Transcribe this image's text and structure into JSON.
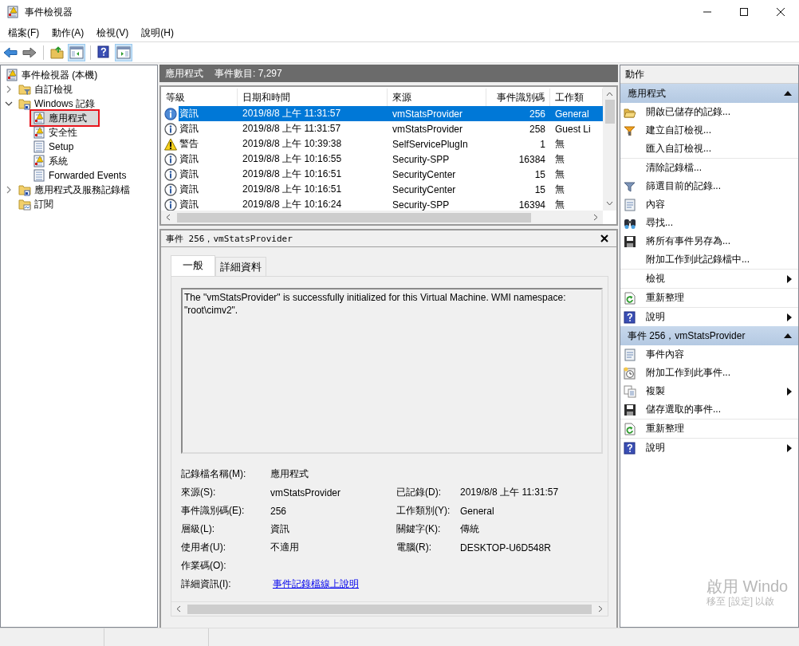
{
  "window": {
    "title": "事件檢視器"
  },
  "menu": [
    "檔案(F)",
    "動作(A)",
    "檢視(V)",
    "說明(H)"
  ],
  "toolbar": [
    {
      "kind": "back",
      "pressed": false
    },
    {
      "kind": "forward",
      "pressed": false
    },
    {
      "kind": "folder-up",
      "pressed": false
    },
    {
      "kind": "tree-pane",
      "pressed": true
    },
    {
      "kind": "help",
      "pressed": false
    },
    {
      "kind": "action-pane",
      "pressed": true
    }
  ],
  "tree": {
    "label": "事件檢視器 (本機)",
    "kind": "root",
    "selected": false,
    "highlighted": false,
    "children": [
      {
        "label": "自訂檢視",
        "kind": "folder-filter",
        "expanded": false,
        "selected": false,
        "highlighted": false
      },
      {
        "label": "Windows 記錄",
        "kind": "folder-logs",
        "expanded": true,
        "selected": false,
        "highlighted": false,
        "children": [
          {
            "label": "應用程式",
            "kind": "log-alert",
            "selected": true,
            "highlighted": true
          },
          {
            "label": "安全性",
            "kind": "log-alert",
            "selected": false,
            "highlighted": false
          },
          {
            "label": "Setup",
            "kind": "log",
            "selected": false,
            "highlighted": false
          },
          {
            "label": "系統",
            "kind": "log-alert",
            "selected": false,
            "highlighted": false
          },
          {
            "label": "Forwarded Events",
            "kind": "log",
            "selected": false,
            "highlighted": false
          }
        ]
      },
      {
        "label": "應用程式及服務記錄檔",
        "kind": "folder-logs",
        "expanded": false,
        "selected": false,
        "highlighted": false
      },
      {
        "label": "訂閱",
        "kind": "folder-sub",
        "selected": false,
        "highlighted": false
      }
    ]
  },
  "log_header": {
    "name": "應用程式",
    "count": "事件數目: 7,297"
  },
  "table": {
    "columns": [
      "等級",
      "日期和時間",
      "來源",
      "事件識別碼",
      "工作類"
    ],
    "rows": [
      {
        "kind": "info",
        "level": "資訊",
        "date": "2019/8/8 上午 11:31:57",
        "source": "vmStatsProvider",
        "id": "256",
        "category": "General",
        "selected": true
      },
      {
        "kind": "info",
        "level": "資訊",
        "date": "2019/8/8 上午 11:31:57",
        "source": "vmStatsProvider",
        "id": "258",
        "category": "Guest Li",
        "selected": false
      },
      {
        "kind": "warning",
        "level": "警告",
        "date": "2019/8/8 上午 10:39:38",
        "source": "SelfServicePlugIn",
        "id": "1",
        "category": "無",
        "selected": false
      },
      {
        "kind": "info",
        "level": "資訊",
        "date": "2019/8/8 上午 10:16:55",
        "source": "Security-SPP",
        "id": "16384",
        "category": "無",
        "selected": false
      },
      {
        "kind": "info",
        "level": "資訊",
        "date": "2019/8/8 上午 10:16:51",
        "source": "SecurityCenter",
        "id": "15",
        "category": "無",
        "selected": false
      },
      {
        "kind": "info",
        "level": "資訊",
        "date": "2019/8/8 上午 10:16:51",
        "source": "SecurityCenter",
        "id": "15",
        "category": "無",
        "selected": false
      },
      {
        "kind": "info",
        "level": "資訊",
        "date": "2019/8/8 上午 10:16:24",
        "source": "Security-SPP",
        "id": "16394",
        "category": "無",
        "selected": false
      }
    ]
  },
  "detail": {
    "title": "事件 256，vmStatsProvider",
    "tabs": [
      {
        "label": "一般",
        "selected": true
      },
      {
        "label": "詳細資料",
        "selected": false
      }
    ],
    "message": "The \"vmStatsProvider\" is successfully initialized for this Virtual Machine. WMI namespace: \"root\\cimv2\".",
    "field_rows": [
      [
        {
          "label": "記錄檔名稱(M):",
          "value": "應用程式"
        }
      ],
      [
        {
          "label": "來源(S):",
          "value": "vmStatsProvider"
        },
        {
          "label": "已記錄(D):",
          "value": "2019/8/8 上午 11:31:57"
        }
      ],
      [
        {
          "label": "事件識別碼(E):",
          "value": "256"
        },
        {
          "label": "工作類別(Y):",
          "value": "General"
        }
      ],
      [
        {
          "label": "層級(L):",
          "value": "資訊"
        },
        {
          "label": "關鍵字(K):",
          "value": "傳統"
        }
      ],
      [
        {
          "label": "使用者(U):",
          "value": "不適用"
        },
        {
          "label": "電腦(R):",
          "value": "DESKTOP-U6D548R"
        }
      ],
      [
        {
          "label": "作業碼(O):"
        }
      ],
      [
        {
          "label": "詳細資訊(I):",
          "value": "事件記錄檔線上說明",
          "kind": "link"
        }
      ]
    ]
  },
  "actions": {
    "title": "動作",
    "sections": [
      {
        "title": "應用程式",
        "expanded": true,
        "items": [
          {
            "kind": "folder-open",
            "label": "開啟已儲存的記錄...",
            "submenu": false,
            "divider_after": false
          },
          {
            "kind": "funnel-new",
            "label": "建立自訂檢視...",
            "submenu": false,
            "divider_after": false
          },
          {
            "kind": "plain",
            "label": "匯入自訂檢視...",
            "submenu": false,
            "divider_after": true
          },
          {
            "kind": "plain",
            "label": "清除記錄檔...",
            "submenu": false,
            "divider_after": false
          },
          {
            "kind": "funnel",
            "label": "篩選目前的記錄...",
            "submenu": false,
            "divider_after": false
          },
          {
            "kind": "properties",
            "label": "內容",
            "submenu": false,
            "divider_after": false
          },
          {
            "kind": "binoculars",
            "label": "尋找...",
            "submenu": false,
            "divider_after": false
          },
          {
            "kind": "floppy",
            "label": "將所有事件另存為...",
            "submenu": false,
            "divider_after": false
          },
          {
            "kind": "plain",
            "label": "附加工作到此記錄檔中...",
            "submenu": false,
            "divider_after": true
          },
          {
            "kind": "plain",
            "label": "檢視",
            "submenu": true,
            "divider_after": true
          },
          {
            "kind": "refresh",
            "label": "重新整理",
            "submenu": false,
            "divider_after": true
          },
          {
            "kind": "help",
            "label": "說明",
            "submenu": true,
            "divider_after": false
          }
        ]
      },
      {
        "title": "事件 256，vmStatsProvider",
        "expanded": true,
        "items": [
          {
            "kind": "properties",
            "label": "事件內容",
            "submenu": false,
            "divider_after": false
          },
          {
            "kind": "task",
            "label": "附加工作到此事件...",
            "submenu": false,
            "divider_after": false
          },
          {
            "kind": "copy",
            "label": "複製",
            "submenu": true,
            "divider_after": false
          },
          {
            "kind": "floppy",
            "label": "儲存選取的事件...",
            "submenu": false,
            "divider_after": true
          },
          {
            "kind": "refresh",
            "label": "重新整理",
            "submenu": false,
            "divider_after": true
          },
          {
            "kind": "help",
            "label": "說明",
            "submenu": true,
            "divider_after": false
          }
        ]
      }
    ]
  },
  "activation_notice": {
    "title": "啟用 Windo",
    "subtitle": "移至 [設定] 以啟"
  }
}
